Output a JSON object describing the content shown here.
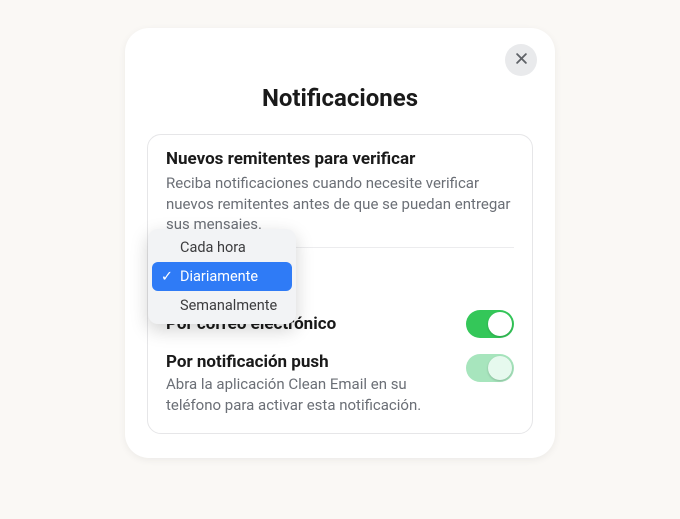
{
  "modal": {
    "title": "Notificaciones"
  },
  "section": {
    "title": "Nuevos remitentes para verificar",
    "description": "Reciba notificaciones cuando necesite verificar nuevos remitentes antes de que se puedan entregar sus mensajes."
  },
  "dropdown": {
    "options": [
      {
        "label": "Cada hora",
        "selected": false
      },
      {
        "label": "Diariamente",
        "selected": true
      },
      {
        "label": "Semanalmente",
        "selected": false
      }
    ]
  },
  "rows": {
    "email": {
      "label": "Por correo electrónico",
      "enabled": true
    },
    "push": {
      "label": "Por notificación push",
      "description": "Abra la aplicación Clean Email en su teléfono para activar esta notificación.",
      "enabled": true
    }
  },
  "colors": {
    "toggle_on": "#34c759",
    "toggle_on_light": "#a7e5bd",
    "accent": "#2f7bf6"
  }
}
